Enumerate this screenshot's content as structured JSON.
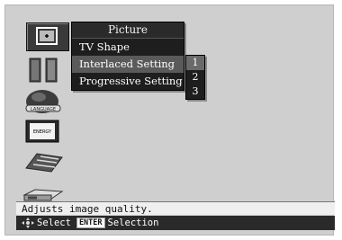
{
  "menu": {
    "title": "Picture",
    "items": [
      {
        "label": "TV Shape"
      },
      {
        "label": "Interlaced Setting"
      },
      {
        "label": "Progressive Setting"
      }
    ]
  },
  "submenu": {
    "options": [
      "1",
      "2",
      "3"
    ],
    "selected": "1"
  },
  "sidebar": {
    "icons": [
      "picture-icon",
      "panels-icon",
      "globe-icon",
      "display-icon",
      "keyboard-icon",
      "receiver-icon"
    ]
  },
  "status": {
    "text": "Adjusts image quality."
  },
  "help": {
    "select_label": "Select",
    "enter_key": "ENTER",
    "selection_label": "Selection"
  },
  "colors": {
    "menu_bg": "#1e1e1e",
    "highlight": "#5a5a5a",
    "screen_bg": "#cfcfcf"
  }
}
